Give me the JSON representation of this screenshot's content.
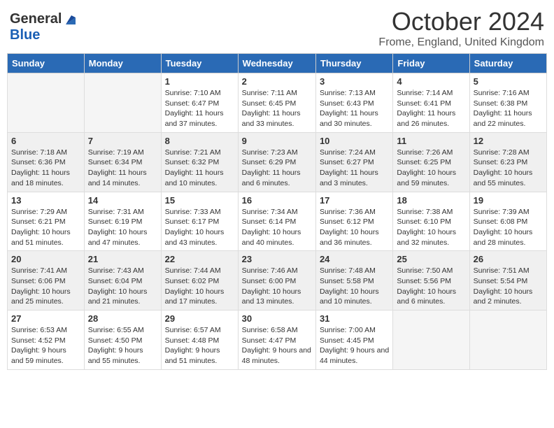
{
  "header": {
    "logo_general": "General",
    "logo_blue": "Blue",
    "month_title": "October 2024",
    "location": "Frome, England, United Kingdom"
  },
  "days_of_week": [
    "Sunday",
    "Monday",
    "Tuesday",
    "Wednesday",
    "Thursday",
    "Friday",
    "Saturday"
  ],
  "weeks": [
    [
      {
        "day": "",
        "info": ""
      },
      {
        "day": "",
        "info": ""
      },
      {
        "day": "1",
        "info": "Sunrise: 7:10 AM\nSunset: 6:47 PM\nDaylight: 11 hours and 37 minutes."
      },
      {
        "day": "2",
        "info": "Sunrise: 7:11 AM\nSunset: 6:45 PM\nDaylight: 11 hours and 33 minutes."
      },
      {
        "day": "3",
        "info": "Sunrise: 7:13 AM\nSunset: 6:43 PM\nDaylight: 11 hours and 30 minutes."
      },
      {
        "day": "4",
        "info": "Sunrise: 7:14 AM\nSunset: 6:41 PM\nDaylight: 11 hours and 26 minutes."
      },
      {
        "day": "5",
        "info": "Sunrise: 7:16 AM\nSunset: 6:38 PM\nDaylight: 11 hours and 22 minutes."
      }
    ],
    [
      {
        "day": "6",
        "info": "Sunrise: 7:18 AM\nSunset: 6:36 PM\nDaylight: 11 hours and 18 minutes."
      },
      {
        "day": "7",
        "info": "Sunrise: 7:19 AM\nSunset: 6:34 PM\nDaylight: 11 hours and 14 minutes."
      },
      {
        "day": "8",
        "info": "Sunrise: 7:21 AM\nSunset: 6:32 PM\nDaylight: 11 hours and 10 minutes."
      },
      {
        "day": "9",
        "info": "Sunrise: 7:23 AM\nSunset: 6:29 PM\nDaylight: 11 hours and 6 minutes."
      },
      {
        "day": "10",
        "info": "Sunrise: 7:24 AM\nSunset: 6:27 PM\nDaylight: 11 hours and 3 minutes."
      },
      {
        "day": "11",
        "info": "Sunrise: 7:26 AM\nSunset: 6:25 PM\nDaylight: 10 hours and 59 minutes."
      },
      {
        "day": "12",
        "info": "Sunrise: 7:28 AM\nSunset: 6:23 PM\nDaylight: 10 hours and 55 minutes."
      }
    ],
    [
      {
        "day": "13",
        "info": "Sunrise: 7:29 AM\nSunset: 6:21 PM\nDaylight: 10 hours and 51 minutes."
      },
      {
        "day": "14",
        "info": "Sunrise: 7:31 AM\nSunset: 6:19 PM\nDaylight: 10 hours and 47 minutes."
      },
      {
        "day": "15",
        "info": "Sunrise: 7:33 AM\nSunset: 6:17 PM\nDaylight: 10 hours and 43 minutes."
      },
      {
        "day": "16",
        "info": "Sunrise: 7:34 AM\nSunset: 6:14 PM\nDaylight: 10 hours and 40 minutes."
      },
      {
        "day": "17",
        "info": "Sunrise: 7:36 AM\nSunset: 6:12 PM\nDaylight: 10 hours and 36 minutes."
      },
      {
        "day": "18",
        "info": "Sunrise: 7:38 AM\nSunset: 6:10 PM\nDaylight: 10 hours and 32 minutes."
      },
      {
        "day": "19",
        "info": "Sunrise: 7:39 AM\nSunset: 6:08 PM\nDaylight: 10 hours and 28 minutes."
      }
    ],
    [
      {
        "day": "20",
        "info": "Sunrise: 7:41 AM\nSunset: 6:06 PM\nDaylight: 10 hours and 25 minutes."
      },
      {
        "day": "21",
        "info": "Sunrise: 7:43 AM\nSunset: 6:04 PM\nDaylight: 10 hours and 21 minutes."
      },
      {
        "day": "22",
        "info": "Sunrise: 7:44 AM\nSunset: 6:02 PM\nDaylight: 10 hours and 17 minutes."
      },
      {
        "day": "23",
        "info": "Sunrise: 7:46 AM\nSunset: 6:00 PM\nDaylight: 10 hours and 13 minutes."
      },
      {
        "day": "24",
        "info": "Sunrise: 7:48 AM\nSunset: 5:58 PM\nDaylight: 10 hours and 10 minutes."
      },
      {
        "day": "25",
        "info": "Sunrise: 7:50 AM\nSunset: 5:56 PM\nDaylight: 10 hours and 6 minutes."
      },
      {
        "day": "26",
        "info": "Sunrise: 7:51 AM\nSunset: 5:54 PM\nDaylight: 10 hours and 2 minutes."
      }
    ],
    [
      {
        "day": "27",
        "info": "Sunrise: 6:53 AM\nSunset: 4:52 PM\nDaylight: 9 hours and 59 minutes."
      },
      {
        "day": "28",
        "info": "Sunrise: 6:55 AM\nSunset: 4:50 PM\nDaylight: 9 hours and 55 minutes."
      },
      {
        "day": "29",
        "info": "Sunrise: 6:57 AM\nSunset: 4:48 PM\nDaylight: 9 hours and 51 minutes."
      },
      {
        "day": "30",
        "info": "Sunrise: 6:58 AM\nSunset: 4:47 PM\nDaylight: 9 hours and 48 minutes."
      },
      {
        "day": "31",
        "info": "Sunrise: 7:00 AM\nSunset: 4:45 PM\nDaylight: 9 hours and 44 minutes."
      },
      {
        "day": "",
        "info": ""
      },
      {
        "day": "",
        "info": ""
      }
    ]
  ]
}
